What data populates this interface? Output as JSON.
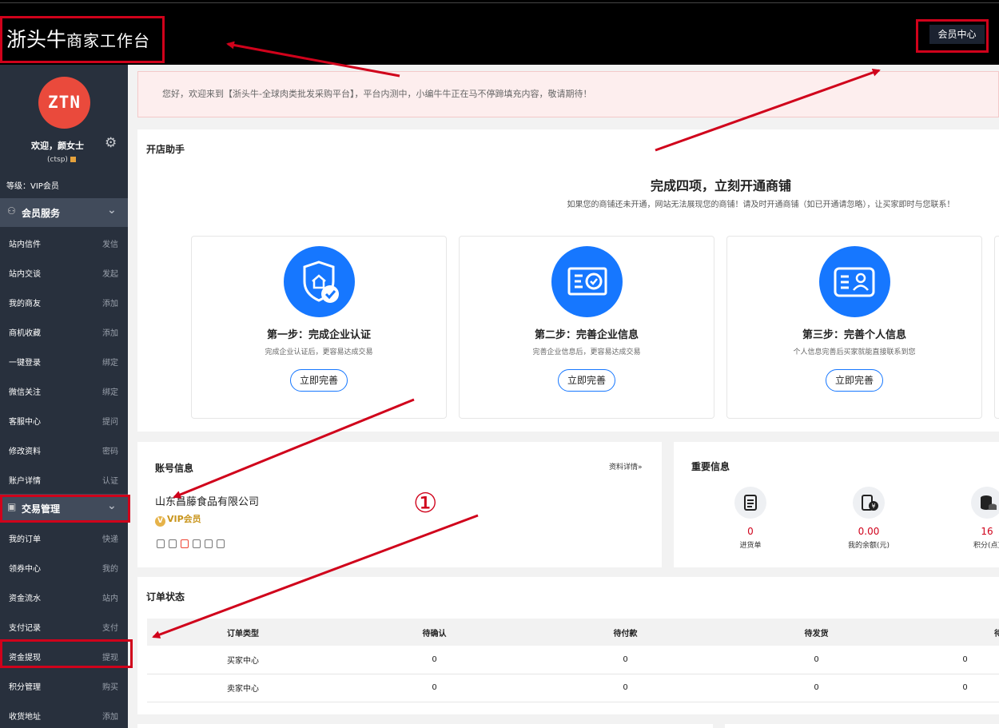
{
  "header": {
    "brand_part1": "浙头牛",
    "brand_part2": "商家工作台",
    "member_center_label": "会员中心"
  },
  "sidebar": {
    "avatar_text": "ZTN",
    "welcome": "欢迎，颜女士",
    "user_id": "(ctsp)",
    "level": "等级：VIP会员",
    "section_member": "会员服务",
    "member_items": [
      {
        "label": "站内信件",
        "action": "发信"
      },
      {
        "label": "站内交谈",
        "action": "发起"
      },
      {
        "label": "我的商友",
        "action": "添加"
      },
      {
        "label": "商机收藏",
        "action": "添加"
      },
      {
        "label": "一键登录",
        "action": "绑定"
      },
      {
        "label": "微信关注",
        "action": "绑定"
      },
      {
        "label": "客服中心",
        "action": "提问"
      },
      {
        "label": "修改资料",
        "action": "密码"
      },
      {
        "label": "账户详情",
        "action": "认证"
      }
    ],
    "section_trade": "交易管理",
    "trade_items": [
      {
        "label": "我的订单",
        "action": "快递"
      },
      {
        "label": "领券中心",
        "action": "我的"
      },
      {
        "label": "资金流水",
        "action": "站内"
      },
      {
        "label": "支付记录",
        "action": "支付"
      },
      {
        "label": "资金提现",
        "action": "提现"
      },
      {
        "label": "积分管理",
        "action": "购买"
      },
      {
        "label": "收货地址",
        "action": "添加"
      }
    ]
  },
  "notice": "您好，欢迎来到【浙头牛-全球肉类批发采购平台】，平台内测中，小编牛牛正在马不停蹄填充内容，敬请期待！",
  "shop_helper": {
    "title": "开店助手",
    "headline": "完成四项，立刻开通商铺",
    "subtext": "如果您的商铺还未开通，网站无法展现您的商铺！请及时开通商铺（如已开通请忽略），让买家即时与您联系！",
    "steps": [
      {
        "title": "第一步：完成企业认证",
        "desc": "完成企业认证后，更容易达成交易",
        "button": "立即完善"
      },
      {
        "title": "第二步：完善企业信息",
        "desc": "完善企业信息后，更容易达成交易",
        "button": "立即完善"
      },
      {
        "title": "第三步：完善个人信息",
        "desc": "个人信息完善后买家就能直接联系到您",
        "button": "立即完善"
      }
    ]
  },
  "account": {
    "title": "账号信息",
    "detail_link": "资料详情»",
    "company": "山东昌藤食品有限公司",
    "vip_badge": "VIP会员"
  },
  "important": {
    "title": "重要信息",
    "stats": [
      {
        "value": "0",
        "label": "进货单"
      },
      {
        "value": "0.00",
        "label": "我的余额(元)"
      },
      {
        "value": "16",
        "label": "积分(点)"
      }
    ]
  },
  "orders": {
    "title": "订单状态",
    "headers": [
      "订单类型",
      "待确认",
      "待付款",
      "待发货",
      "待收货"
    ],
    "rows": [
      [
        "买家中心",
        "0",
        "0",
        "0",
        "0"
      ],
      [
        "卖家中心",
        "0",
        "0",
        "0",
        "0"
      ]
    ]
  },
  "annotation_marker": "①",
  "colors": {
    "accent_blue": "#1677ff",
    "annotation_red": "#d0021b",
    "sidebar_bg": "#28303d",
    "section_bg": "#414b5b",
    "avatar_red": "#ea4a3c"
  }
}
